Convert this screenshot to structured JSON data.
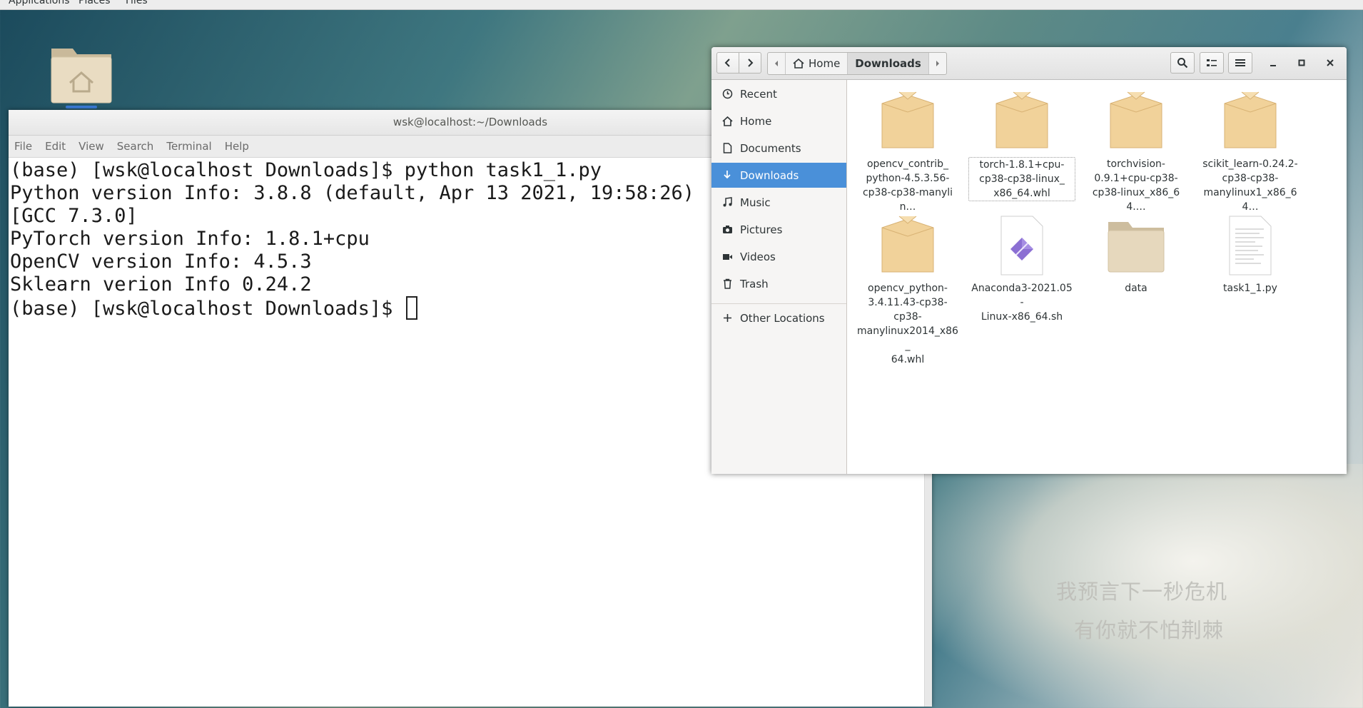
{
  "topbar": {
    "applications": "Applications",
    "places": "Places",
    "files": "Files"
  },
  "terminal": {
    "title": "wsk@localhost:~/Downloads",
    "menu": [
      "File",
      "Edit",
      "View",
      "Search",
      "Terminal",
      "Help"
    ],
    "lines": [
      "(base) [wsk@localhost Downloads]$ python task1_1.py",
      "Python version Info: 3.8.8 (default, Apr 13 2021, 19:58:26)",
      "[GCC 7.3.0]",
      "PyTorch version Info: 1.8.1+cpu",
      "OpenCV version Info: 4.5.3",
      "Sklearn verion Info 0.24.2",
      "(base) [wsk@localhost Downloads]$ "
    ]
  },
  "files": {
    "path": [
      "Home",
      "Downloads"
    ],
    "sidebar": [
      {
        "label": "Recent",
        "icon": "clock-icon"
      },
      {
        "label": "Home",
        "icon": "home-icon"
      },
      {
        "label": "Documents",
        "icon": "document-icon"
      },
      {
        "label": "Downloads",
        "icon": "download-icon",
        "selected": true
      },
      {
        "label": "Music",
        "icon": "music-icon"
      },
      {
        "label": "Pictures",
        "icon": "camera-icon"
      },
      {
        "label": "Videos",
        "icon": "video-icon"
      },
      {
        "label": "Trash",
        "icon": "trash-icon"
      },
      {
        "label": "Other Locations",
        "icon": "plus-icon"
      }
    ],
    "items": [
      {
        "name": "opencv_contrib_\npython-4.5.3.56-\ncp38-cp38-manylin…",
        "type": "package"
      },
      {
        "name": "torch-1.8.1+cpu-\ncp38-cp38-linux_\nx86_64.whl",
        "type": "package",
        "focused": true
      },
      {
        "name": "torchvision-\n0.9.1+cpu-cp38-\ncp38-linux_x86_64.…",
        "type": "package"
      },
      {
        "name": "scikit_learn-0.24.2-\ncp38-cp38-\nmanylinux1_x86_64…",
        "type": "package"
      },
      {
        "name": "opencv_python-\n3.4.11.43-cp38-\ncp38-\nmanylinux2014_x86_\n64.whl",
        "type": "package"
      },
      {
        "name": "Anaconda3-2021.05-\nLinux-x86_64.sh",
        "type": "script"
      },
      {
        "name": "data",
        "type": "folder"
      },
      {
        "name": "task1_1.py",
        "type": "text"
      }
    ]
  },
  "desktop": {
    "icon": "home-folder-icon"
  },
  "watermark": [
    "我预言下一秒危机",
    "有你就不怕荆棘"
  ]
}
